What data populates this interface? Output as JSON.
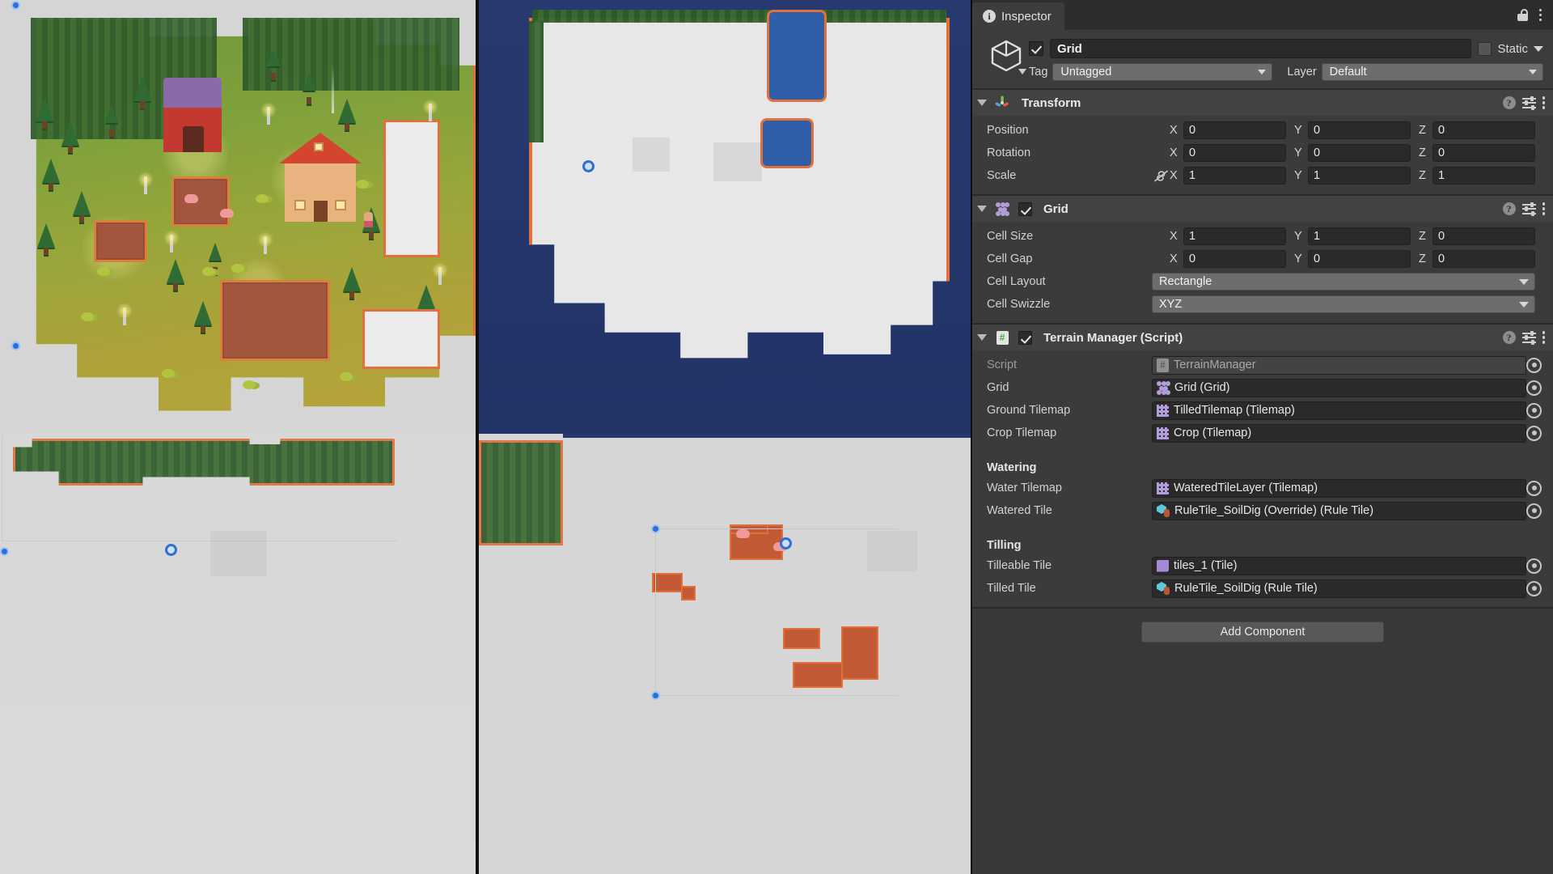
{
  "inspector": {
    "tab_label": "Inspector",
    "tab_icon": "info-icon",
    "lock_icon": "lock-open-icon",
    "menu_icon": "kebab-menu-icon",
    "object": {
      "enabled": true,
      "name": "Grid",
      "static_label": "Static",
      "tag_label": "Tag",
      "tag_value": "Untagged",
      "layer_label": "Layer",
      "layer_value": "Default"
    },
    "components": [
      {
        "title": "Transform",
        "icon": "transform-gizmo-icon",
        "has_checkbox": false,
        "rows": [
          {
            "label": "Position",
            "type": "vector3",
            "x": "0",
            "y": "0",
            "z": "0",
            "link": false
          },
          {
            "label": "Rotation",
            "type": "vector3",
            "x": "0",
            "y": "0",
            "z": "0",
            "link": false
          },
          {
            "label": "Scale",
            "type": "vector3",
            "x": "1",
            "y": "1",
            "z": "1",
            "link": true
          }
        ]
      },
      {
        "title": "Grid",
        "icon": "grid-component-icon",
        "has_checkbox": true,
        "enabled": true,
        "rows": [
          {
            "label": "Cell Size",
            "type": "vector3",
            "x": "1",
            "y": "1",
            "z": "0",
            "link": false
          },
          {
            "label": "Cell Gap",
            "type": "vector3",
            "x": "0",
            "y": "0",
            "z": "0",
            "link": false
          },
          {
            "label": "Cell Layout",
            "type": "dropdown",
            "value": "Rectangle"
          },
          {
            "label": "Cell Swizzle",
            "type": "dropdown",
            "value": "XYZ"
          }
        ]
      },
      {
        "title": "Terrain Manager (Script)",
        "icon": "cs-script-icon",
        "has_checkbox": true,
        "enabled": true,
        "rows": [
          {
            "label": "Script",
            "type": "object",
            "value": "TerrainManager",
            "icon": "cs-script-icon",
            "readonly": true
          },
          {
            "label": "Grid",
            "type": "object",
            "value": "Grid (Grid)",
            "icon": "grid-component-icon"
          },
          {
            "label": "Ground Tilemap",
            "type": "object",
            "value": "TilledTilemap (Tilemap)",
            "icon": "tilemap-icon"
          },
          {
            "label": "Crop Tilemap",
            "type": "object",
            "value": "Crop (Tilemap)",
            "icon": "tilemap-icon"
          },
          {
            "type": "spacer"
          },
          {
            "type": "section",
            "label": "Watering"
          },
          {
            "label": "Water Tilemap",
            "type": "object",
            "value": "WateredTileLayer (Tilemap)",
            "icon": "tilemap-icon"
          },
          {
            "label": "Watered Tile",
            "type": "object",
            "value": "RuleTile_SoilDig (Override) (Rule Tile)",
            "icon": "rule-tile-icon"
          },
          {
            "type": "spacer"
          },
          {
            "type": "section",
            "label": "Tilling"
          },
          {
            "label": "Tilleable Tile",
            "type": "object",
            "value": "tiles_1 (Tile)",
            "icon": "tile-asset-icon"
          },
          {
            "label": "Tilled Tile",
            "type": "object",
            "value": "RuleTile_SoilDig (Rule Tile)",
            "icon": "rule-tile-icon"
          }
        ]
      }
    ],
    "add_component_label": "Add Component",
    "help_icon": "help-icon",
    "preset_icon": "preset-settings-icon"
  },
  "scene": {
    "views": [
      {
        "name": "scene-view-colored",
        "description": "Farm tilemap colored view"
      },
      {
        "name": "scene-view-water",
        "description": "Water tilemap overlay view"
      },
      {
        "name": "scene-view-forest",
        "description": "Forest tilemap isolated view"
      },
      {
        "name": "scene-view-tilled",
        "description": "Tilled soil tilemap isolated view"
      }
    ]
  },
  "colors": {
    "panel_bg": "#383838",
    "component_header": "#424242",
    "field_bg": "#2a2a2a",
    "dropdown_bg": "#6d6d6d",
    "accent_orange": "#e2703a",
    "soil_red": "#c25a35",
    "water_blue": "#24386b",
    "grid_purple": "#b39ddb",
    "script_green": "#4aa84a"
  }
}
